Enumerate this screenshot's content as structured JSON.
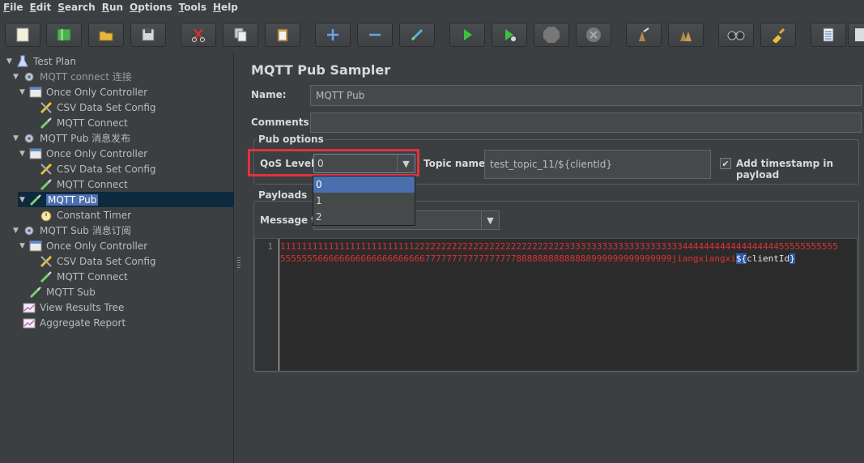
{
  "menu": [
    "File",
    "Edit",
    "Search",
    "Run",
    "Options",
    "Tools",
    "Help"
  ],
  "menu_accel": [
    "F",
    "E",
    "S",
    "R",
    "O",
    "T",
    "H"
  ],
  "toolbar": {
    "buttons": [
      "new-icon",
      "templates-icon",
      "open-icon",
      "save-icon",
      "cut-icon",
      "copy-icon",
      "paste-icon",
      "expand-icon",
      "collapse-icon",
      "toggle-icon",
      "start-icon",
      "start-no-pause-icon",
      "stop-icon",
      "shutdown-icon",
      "clear-icon",
      "clear-all-icon",
      "search-icon",
      "reset-search-icon",
      "function-helper-icon",
      "help-icon"
    ]
  },
  "tree": {
    "items": [
      {
        "label": "Test Plan",
        "icon": "test-plan-icon",
        "level": 0,
        "exp": "▼"
      },
      {
        "label": "MQTT connect 连接",
        "icon": "thread-group-icon",
        "level": 1,
        "exp": "▼",
        "dim": true
      },
      {
        "label": "Once Only Controller",
        "icon": "controller-icon",
        "level": 2,
        "exp": "▼"
      },
      {
        "label": "CSV Data Set Config",
        "icon": "config-icon",
        "level": 3,
        "exp": ""
      },
      {
        "label": "MQTT Connect",
        "icon": "sampler-icon",
        "level": 3,
        "exp": ""
      },
      {
        "label": "MQTT Pub 消息发布",
        "icon": "thread-group-icon",
        "level": 1,
        "exp": "▼"
      },
      {
        "label": "Once Only Controller",
        "icon": "controller-icon",
        "level": 2,
        "exp": "▼"
      },
      {
        "label": "CSV Data Set Config",
        "icon": "config-icon",
        "level": 3,
        "exp": ""
      },
      {
        "label": "MQTT Connect",
        "icon": "sampler-icon",
        "level": 3,
        "exp": ""
      },
      {
        "label": "MQTT Pub",
        "icon": "sampler-icon",
        "level": 2,
        "exp": "▼",
        "selected": true
      },
      {
        "label": "Constant Timer",
        "icon": "timer-icon",
        "level": 3,
        "exp": ""
      },
      {
        "label": "MQTT Sub 消息订阅",
        "icon": "thread-group-icon",
        "level": 1,
        "exp": "▼"
      },
      {
        "label": "Once Only Controller",
        "icon": "controller-icon",
        "level": 2,
        "exp": "▼"
      },
      {
        "label": "CSV Data Set Config",
        "icon": "config-icon",
        "level": 3,
        "exp": ""
      },
      {
        "label": "MQTT Connect",
        "icon": "sampler-icon",
        "level": 3,
        "exp": ""
      },
      {
        "label": "MQTT Sub",
        "icon": "sampler-icon",
        "level": 2,
        "exp": ""
      },
      {
        "label": "View Results Tree",
        "icon": "listener-icon",
        "level": 1,
        "exp": ""
      },
      {
        "label": "Aggregate Report",
        "icon": "listener-icon",
        "level": 1,
        "exp": ""
      }
    ]
  },
  "panel": {
    "title": "MQTT Pub Sampler",
    "name_label": "Name:",
    "name_value": "MQTT Pub",
    "comments_label": "Comments:",
    "comments_value": "",
    "pub_options_title": "Pub options",
    "qos_label": "QoS Level:",
    "qos_value": "0",
    "qos_options": [
      "0",
      "1",
      "2"
    ],
    "topic_label": "Topic name:",
    "topic_value": "test_topic_11/${clientId}",
    "timestamp_label": "Add timestamp in payload",
    "timestamp_checked": true,
    "payloads_title": "Payloads",
    "message_type_label": "Message ty",
    "message_type_value": "",
    "line_number": "1",
    "payload_text": "111111111111111111111111122222222222222222222222222223333333333333333333333444444444444444444555555555555555555666666666666666666667777777777777777788888888888888999999999999999jiangxiangxi",
    "payload_open": "${",
    "payload_var": "clientId",
    "payload_close": "}"
  },
  "colors": {
    "background": "#3c3f41",
    "selection": "#4b6eaf",
    "highlight_box": "#e0333a",
    "payload_text": "#e03030"
  }
}
